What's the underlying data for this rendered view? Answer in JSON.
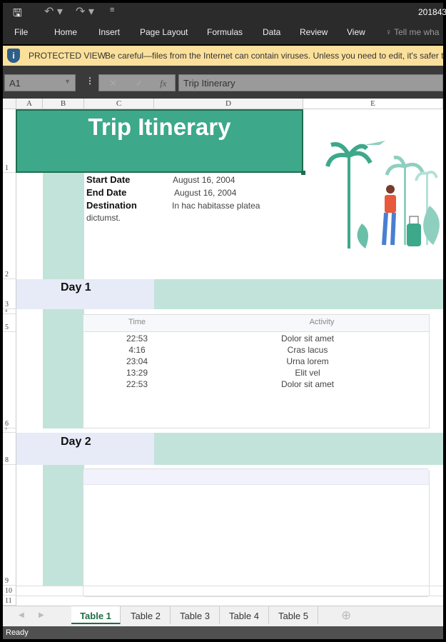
{
  "titlebar": {
    "filename": "201843"
  },
  "ribbon": {
    "tabs": [
      "File",
      "Home",
      "Insert",
      "Page Layout",
      "Formulas",
      "Data",
      "Review",
      "View"
    ],
    "tell_me": "Tell me wha"
  },
  "protected": {
    "label": "PROTECTED VIEW",
    "message": "Be careful—files from the Internet can contain viruses. Unless you need to edit, it's safer to"
  },
  "formula_bar": {
    "name_box": "A1",
    "formula": "Trip Itinerary",
    "fx": "fx"
  },
  "columns": [
    "A",
    "B",
    "C",
    "D",
    "E"
  ],
  "rows": [
    "1",
    "2",
    "3",
    "4",
    "5",
    "6",
    "7",
    "8",
    "9",
    "10",
    "11"
  ],
  "sheet": {
    "title": "Trip Itinerary",
    "start_label": "Start Date",
    "start_value": "August 16, 2004",
    "end_label": "End Date",
    "end_value": "August 16, 2004",
    "dest_label": "Destination",
    "dest_value": "In hac habitasse platea",
    "dest_cont": "dictumst.",
    "day1": "Day 1",
    "day2": "Day 2",
    "time_header": "Time",
    "activity_header": "Activity",
    "entries": [
      {
        "time": "22:53",
        "activity": "Dolor sit amet"
      },
      {
        "time": "4:16",
        "activity": "Cras lacus"
      },
      {
        "time": "23:04",
        "activity": "Urna lorem"
      },
      {
        "time": "13:29",
        "activity": "Elit vel"
      },
      {
        "time": "22:53",
        "activity": "Dolor sit amet"
      }
    ]
  },
  "sheet_tabs": [
    "Table 1",
    "Table 2",
    "Table 3",
    "Table 4",
    "Table 5"
  ],
  "active_tab": "Table 1",
  "status": "Ready",
  "colors": {
    "accent": "#3da88a",
    "band": "#c2e3da",
    "dayband": "#e6ebf7",
    "protected": "#fbe09b"
  }
}
